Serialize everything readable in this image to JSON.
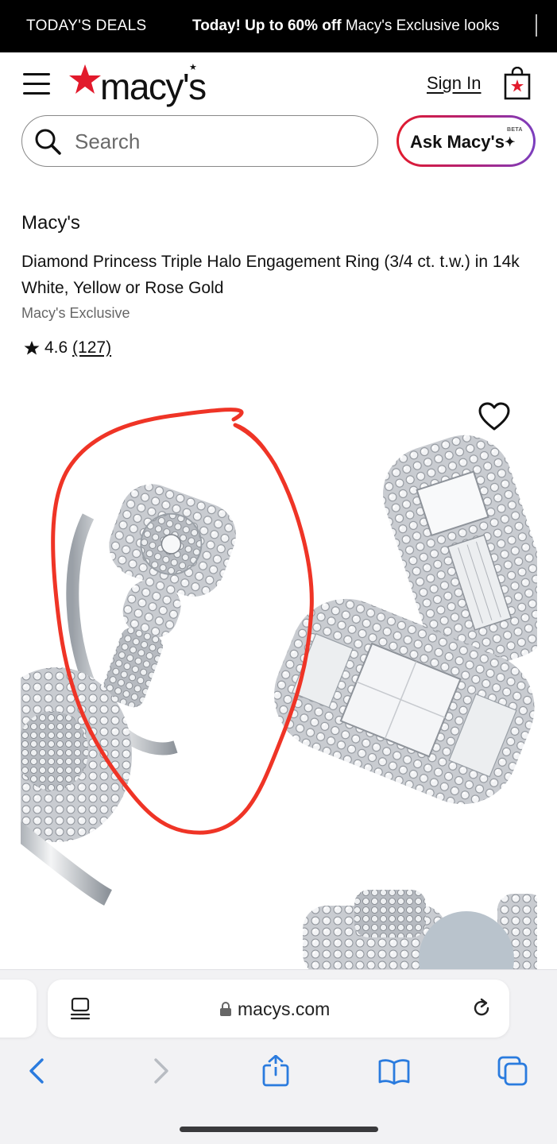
{
  "promo": {
    "deals_label": "TODAY'S DEALS",
    "headline_bold": "Today! Up to 60% off",
    "headline_rest": "Macy's Exclusive looks"
  },
  "header": {
    "logo_text": "macy's",
    "sign_in": "Sign In",
    "search_placeholder": "Search",
    "ask_label": "Ask Macy's",
    "ask_badge": "BETA",
    "accent_color": "#e21a2c"
  },
  "product": {
    "brand": "Macy's",
    "title": "Diamond Princess Triple Halo Engagement Ring (3/4 ct. t.w.) in 14k White, Yellow or Rose Gold",
    "badge": "Macy's Exclusive",
    "rating": "4.6",
    "review_count": "(127)",
    "image_annotation_color": "#ef3426"
  },
  "browser": {
    "url": "macys.com"
  },
  "icons": [
    "menu-icon",
    "macys-star-logo",
    "shopping-bag-icon",
    "search-icon",
    "sparkle-icon",
    "star-icon",
    "heart-icon",
    "tabs-overview-icon",
    "lock-icon",
    "reload-icon",
    "back-icon",
    "forward-icon",
    "share-icon",
    "bookmarks-icon",
    "tabs-icon"
  ]
}
